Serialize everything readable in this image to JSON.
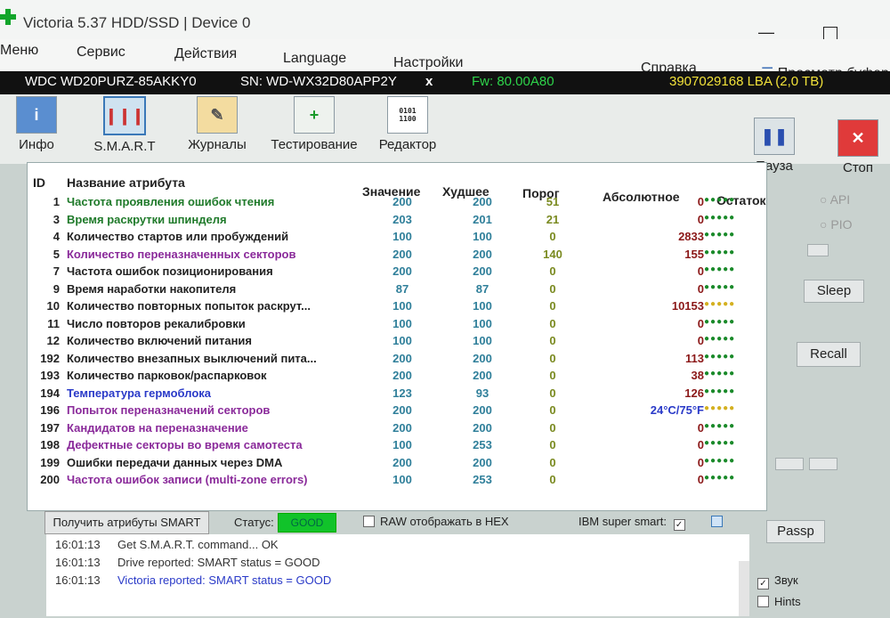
{
  "window": {
    "title": "Victoria 5.37 HDD/SSD | Device 0"
  },
  "menu": [
    "Меню",
    "Сервис",
    "Действия",
    "Language",
    "Настройки",
    "Справка",
    "Просмотр буфер"
  ],
  "drive": {
    "model": "WDC WD20PURZ-85AKKY0",
    "serial": "SN: WD-WX32D80APP2Y",
    "close": "x",
    "firmware": "Fw: 80.00A80",
    "lba": "3907029168 LBA (2,0 TB)"
  },
  "toolbar": [
    "Инфо",
    "S.M.A.R.T",
    "Журналы",
    "Тестирование",
    "Редактор"
  ],
  "controls": {
    "pause": "Пауза",
    "stop": "Стоп"
  },
  "table": {
    "headers": {
      "id": "ID",
      "name": "Название атрибута",
      "value": "Значение",
      "worst": "Худшее",
      "threshold": "Порог",
      "raw": "Абсолютное",
      "health": "Остаток"
    },
    "rows": [
      {
        "id": "1",
        "name": "Частота проявления ошибок чтения",
        "value": "200",
        "worst": "200",
        "threshold": "51",
        "raw": "0",
        "color": "#1f7a2a",
        "health": "green"
      },
      {
        "id": "3",
        "name": "Время раскрутки шпинделя",
        "value": "203",
        "worst": "201",
        "threshold": "21",
        "raw": "0",
        "color": "#1f7a2a",
        "health": "green"
      },
      {
        "id": "4",
        "name": "Количество стартов или пробуждений",
        "value": "100",
        "worst": "100",
        "threshold": "0",
        "raw": "2833",
        "color": "#222222",
        "health": "green"
      },
      {
        "id": "5",
        "name": "Количество переназначенных секторов",
        "value": "200",
        "worst": "200",
        "threshold": "140",
        "raw": "155",
        "color": "#8a2a9a",
        "health": "green"
      },
      {
        "id": "7",
        "name": "Частота ошибок позиционирования",
        "value": "200",
        "worst": "200",
        "threshold": "0",
        "raw": "0",
        "color": "#222222",
        "health": "green"
      },
      {
        "id": "9",
        "name": "Время наработки накопителя",
        "value": "87",
        "worst": "87",
        "threshold": "0",
        "raw": "0",
        "color": "#222222",
        "health": "green"
      },
      {
        "id": "10",
        "name": "Количество повторных попыток раскрут...",
        "value": "100",
        "worst": "100",
        "threshold": "0",
        "raw": "10153",
        "color": "#222222",
        "health": "yellow"
      },
      {
        "id": "11",
        "name": "Число повторов рекалибровки",
        "value": "100",
        "worst": "100",
        "threshold": "0",
        "raw": "0",
        "color": "#222222",
        "health": "green"
      },
      {
        "id": "12",
        "name": "Количество включений питания",
        "value": "100",
        "worst": "100",
        "threshold": "0",
        "raw": "0",
        "color": "#222222",
        "health": "green"
      },
      {
        "id": "192",
        "name": "Количество внезапных выключений пита...",
        "value": "200",
        "worst": "200",
        "threshold": "0",
        "raw": "113",
        "color": "#222222",
        "health": "green"
      },
      {
        "id": "193",
        "name": "Количество парковок/распарковок",
        "value": "200",
        "worst": "200",
        "threshold": "0",
        "raw": "38",
        "color": "#222222",
        "health": "green"
      },
      {
        "id": "194",
        "name": "Температура гермоблока",
        "value": "123",
        "worst": "93",
        "threshold": "0",
        "raw": "126",
        "color": "#2a3ac8",
        "health": "green"
      },
      {
        "id": "196",
        "name": "Попыток переназначений секторов",
        "value": "200",
        "worst": "200",
        "threshold": "0",
        "raw": "24°C/75°F",
        "color": "#8a2a9a",
        "health": "yellow"
      },
      {
        "id": "197",
        "name": "Кандидатов на переназначение",
        "value": "200",
        "worst": "200",
        "threshold": "0",
        "raw": "0",
        "color": "#8a2a9a",
        "health": "green"
      },
      {
        "id": "198",
        "name": "Дефектные секторы во время самотеста",
        "value": "100",
        "worst": "253",
        "threshold": "0",
        "raw": "0",
        "color": "#8a2a9a",
        "health": "green"
      },
      {
        "id": "199",
        "name": "Ошибки передачи данных через DMA",
        "value": "200",
        "worst": "200",
        "threshold": "0",
        "raw": "0",
        "color": "#222222",
        "health": "green"
      },
      {
        "id": "200",
        "name": "Частота ошибок записи (multi-zone errors)",
        "value": "100",
        "worst": "253",
        "threshold": "0",
        "raw": "0",
        "color": "#8a2a9a",
        "health": "green"
      }
    ]
  },
  "bottom": {
    "get_smart": "Получить атрибуты SMART",
    "status_label": "Статус:",
    "status_value": "GOOD",
    "raw_hex": "RAW отображать в HEX",
    "ibm": "IBM super smart:"
  },
  "log": [
    {
      "time": "16:01:13",
      "text": "Get S.M.A.R.T. command... OK",
      "color": "#333333"
    },
    {
      "time": "16:01:13",
      "text": "Drive reported: SMART status = GOOD",
      "color": "#333333"
    },
    {
      "time": "16:01:13",
      "text": "Victoria reported: SMART status = GOOD",
      "color": "#2a3ac8"
    }
  ],
  "right": {
    "api": "API",
    "pio": "PIO",
    "sleep": "Sleep",
    "recall": "Recall",
    "passp": "Passp",
    "sound": "Звук",
    "hints": "Hints"
  },
  "colors": {
    "health_green": "#1a8a2a",
    "health_yellow": "#d4b020",
    "status_good": "#11c32a"
  }
}
